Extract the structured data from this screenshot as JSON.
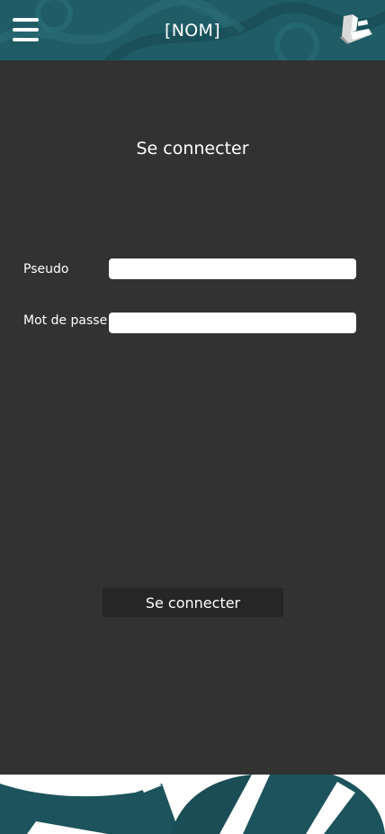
{
  "header": {
    "title": "[NOM]",
    "menu_icon": "hamburger-menu-icon",
    "logo_icon": "app-logo-icon"
  },
  "login": {
    "title": "Se connecter",
    "username_label": "Pseudo",
    "username_value": "",
    "password_label": "Mot de passe",
    "password_value": "",
    "submit_label": "Se connecter"
  },
  "colors": {
    "header_bg": "#1f5c66",
    "panel_bg": "#323232",
    "button_bg": "#262626",
    "accent_teal": "#1c535c"
  }
}
